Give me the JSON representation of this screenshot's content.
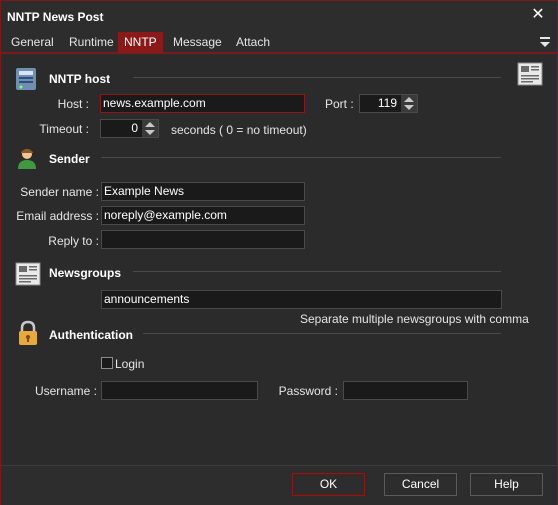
{
  "window": {
    "title": "NNTP News Post",
    "close_glyph": "✕"
  },
  "tabs": [
    {
      "label": "General"
    },
    {
      "label": "Runtime"
    },
    {
      "label": "NNTP",
      "active": true
    },
    {
      "label": "Message"
    },
    {
      "label": "Attach"
    }
  ],
  "nntp_host": {
    "title": "NNTP host",
    "host_label": "Host :",
    "host_value": "news.example.com",
    "port_label": "Port :",
    "port_value": "119",
    "timeout_label": "Timeout :",
    "timeout_value": "0",
    "timeout_hint": "seconds ( 0 = no timeout)"
  },
  "sender": {
    "title": "Sender",
    "name_label": "Sender name :",
    "name_value": "Example News",
    "email_label": "Email address :",
    "email_value": "noreply@example.com",
    "reply_label": "Reply to :",
    "reply_value": ""
  },
  "newsgroups": {
    "title": "Newsgroups",
    "value": "announcements",
    "hint": "Separate multiple newsgroups with comma"
  },
  "authentication": {
    "title": "Authentication",
    "login_label": "Login",
    "login_checked": false,
    "username_label": "Username :",
    "username_value": "",
    "password_label": "Password :",
    "password_value": ""
  },
  "footer": {
    "ok_label": "OK",
    "cancel_label": "Cancel",
    "help_label": "Help"
  },
  "colors": {
    "accent": "#8a1a1a",
    "background": "#2b2b2b",
    "input_bg": "#1a1a1a"
  }
}
